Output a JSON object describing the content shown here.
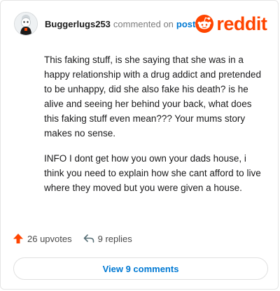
{
  "header": {
    "username": "Buggerlugs253",
    "commented_text": "commented on",
    "post_link": "post",
    "brand": "reddit"
  },
  "comment": {
    "paragraphs": [
      "This faking stuff, is she saying that she was in a happy relationship with a drug addict and pretended to be unhappy, did she also fake his death? is he alive and seeing her behind your back, what does this faking stuff even mean??? Your mums story makes no sense.",
      "INFO I dont get how you own your dads house, i think you need to explain how she cant afford to live where they moved but you were given a house."
    ]
  },
  "footer": {
    "upvotes": "26 upvotes",
    "replies": "9 replies",
    "view_comments": "View 9 comments"
  },
  "colors": {
    "brand": "#ff4500",
    "link": "#0079d3",
    "upvote": "#ff4500"
  },
  "icons": {
    "brand_icon": "reddit-snoo-icon",
    "upvote_icon": "upvote-arrow-icon",
    "reply_icon": "reply-arrow-icon",
    "avatar": "user-avatar"
  }
}
